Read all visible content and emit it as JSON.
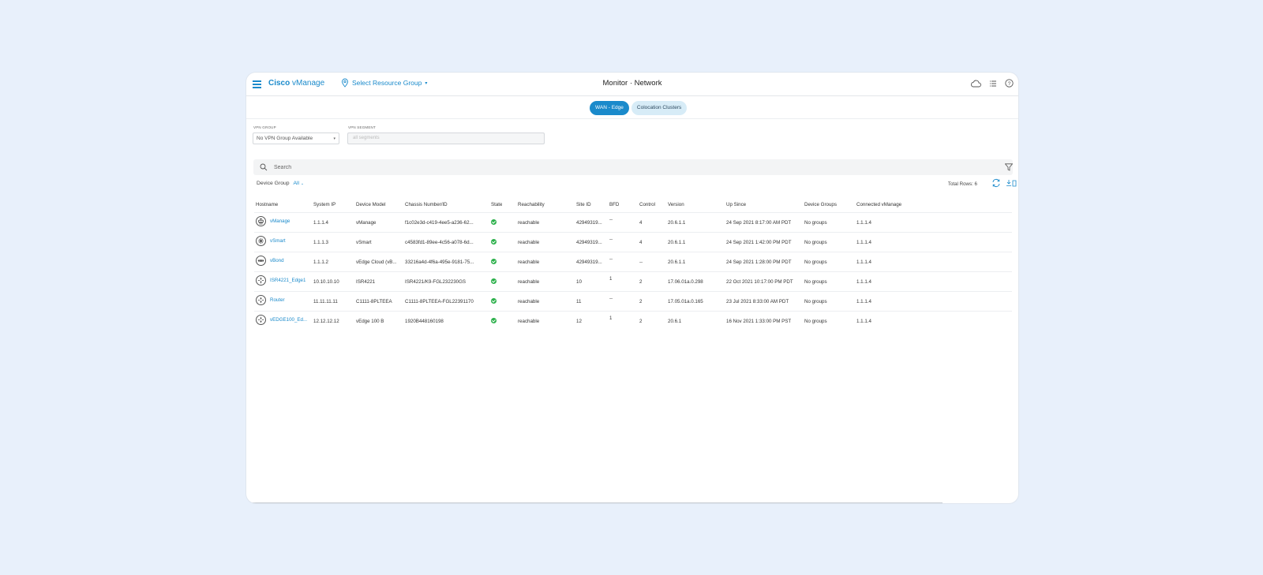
{
  "header": {
    "brand_bold": "Cisco",
    "brand_rest": " vManage",
    "resource_group": "Select Resource Group",
    "page_title": "Monitor · Network"
  },
  "tabs": [
    {
      "label": "WAN - Edge",
      "active": true
    },
    {
      "label": "Colocation Clusters",
      "active": false
    }
  ],
  "filters": {
    "vpn_group_label": "VPN GROUP",
    "vpn_group_value": "No VPN Group Available",
    "vpn_segment_label": "VPN SEGMENT",
    "vpn_segment_placeholder": "all segments"
  },
  "search": {
    "placeholder": "Search"
  },
  "device_group": {
    "label": "Device Group",
    "value": "All"
  },
  "total_rows": "Total Rows: 6",
  "table": {
    "columns": [
      "Hostname",
      "System IP",
      "Device Model",
      "Chassis Number/ID",
      "State",
      "Reachability",
      "Site ID",
      "BFD",
      "Control",
      "Version",
      "Up Since",
      "Device Groups",
      "Connected vManage"
    ],
    "rows": [
      {
        "hostname": "vManage",
        "icon": "vmanage-icon",
        "system_ip": "1.1.1.4",
        "model": "vManage",
        "chassis": "f1c02e3d-c419-4ee5-a236-62...",
        "state": "green",
        "reachability": "reachable",
        "site_id": "42949319...",
        "bfd": "--",
        "control": "4",
        "version": "20.6.1.1",
        "up_since": "24 Sep 2021 8:17:00 AM PDT",
        "device_groups": "No groups",
        "connected_vmanage": "1.1.1.4"
      },
      {
        "hostname": "vSmart",
        "icon": "vsmart-icon",
        "system_ip": "1.1.1.3",
        "model": "vSmart",
        "chassis": "c4583fd1-89ee-4c56-a078-6d...",
        "state": "green",
        "reachability": "reachable",
        "site_id": "42949319...",
        "bfd": "--",
        "control": "4",
        "version": "20.6.1.1",
        "up_since": "24 Sep 2021 1:42:00 PM PDT",
        "device_groups": "No groups",
        "connected_vmanage": "1.1.1.4"
      },
      {
        "hostname": "vBond",
        "icon": "vbond-icon",
        "system_ip": "1.1.1.2",
        "model": "vEdge Cloud (vB...",
        "chassis": "33216a4d-4f6a-495e-9181-75...",
        "state": "green",
        "reachability": "reachable",
        "site_id": "42949319...",
        "bfd": "--",
        "control": "--",
        "version": "20.6.1.1",
        "up_since": "24 Sep 2021 1:28:00 PM PDT",
        "device_groups": "No groups",
        "connected_vmanage": "1.1.1.4"
      },
      {
        "hostname": "ISR4221_Edge1",
        "icon": "router-icon",
        "system_ip": "10.10.10.10",
        "model": "ISR4221",
        "chassis": "ISR4221/K9-FGL232230GS",
        "state": "green",
        "reachability": "reachable",
        "site_id": "10",
        "bfd": "1",
        "control": "2",
        "version": "17.06.01a.0.298",
        "up_since": "22 Oct 2021 10:17:00 PM PDT",
        "device_groups": "No groups",
        "connected_vmanage": "1.1.1.4"
      },
      {
        "hostname": "Router",
        "icon": "router-icon",
        "system_ip": "11.11.11.11",
        "model": "C1111-8PLTEEA",
        "chassis": "C1111-8PLTEEA-FGL22391170",
        "state": "green",
        "reachability": "reachable",
        "site_id": "11",
        "bfd": "--",
        "control": "2",
        "version": "17.05.01a.0.165",
        "up_since": "23 Jul 2021 8:33:00 AM PDT",
        "device_groups": "No groups",
        "connected_vmanage": "1.1.1.4"
      },
      {
        "hostname": "vEDGE100_Ed...",
        "icon": "router-icon",
        "system_ip": "12.12.12.12",
        "model": "vEdge 100 B",
        "chassis": "1920B448160198",
        "state": "green",
        "reachability": "reachable",
        "site_id": "12",
        "bfd": "1",
        "control": "2",
        "version": "20.6.1",
        "up_since": "16 Nov 2021 1:33:00 PM PST",
        "device_groups": "No groups",
        "connected_vmanage": "1.1.1.4"
      }
    ]
  },
  "colors": {
    "accent": "#1a8acb",
    "state_ok": "#2cb04b",
    "background": "#e8f0fb"
  }
}
